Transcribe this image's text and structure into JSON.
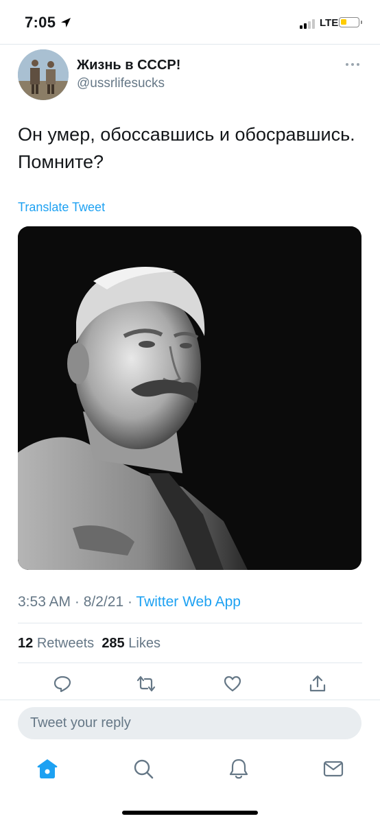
{
  "status_bar": {
    "time": "7:05",
    "network": "LTE",
    "battery_level": 0.35,
    "battery_color": "#ffcc00",
    "signal_bars": 2
  },
  "tweet": {
    "display_name": "Жизнь в СССР!",
    "handle": "@ussrlifesucks",
    "text": "Он умер, обоссавшись и обосравшись. Помните?",
    "translate_label": "Translate Tweet",
    "time": "3:53 AM",
    "date": "8/2/21",
    "source": "Twitter Web App",
    "retweets_count": "12",
    "retweets_label": "Retweets",
    "likes_count": "285",
    "likes_label": "Likes"
  },
  "actions": [
    "reply-icon",
    "retweet-icon",
    "like-icon",
    "share-icon"
  ],
  "reply": {
    "placeholder": "Tweet your reply"
  },
  "tab_bar": [
    "home-icon",
    "search-icon",
    "notifications-icon",
    "messages-icon"
  ],
  "colors": {
    "accent": "#1da1f2",
    "secondary_text": "#657786",
    "divider": "#e1e8ed"
  }
}
